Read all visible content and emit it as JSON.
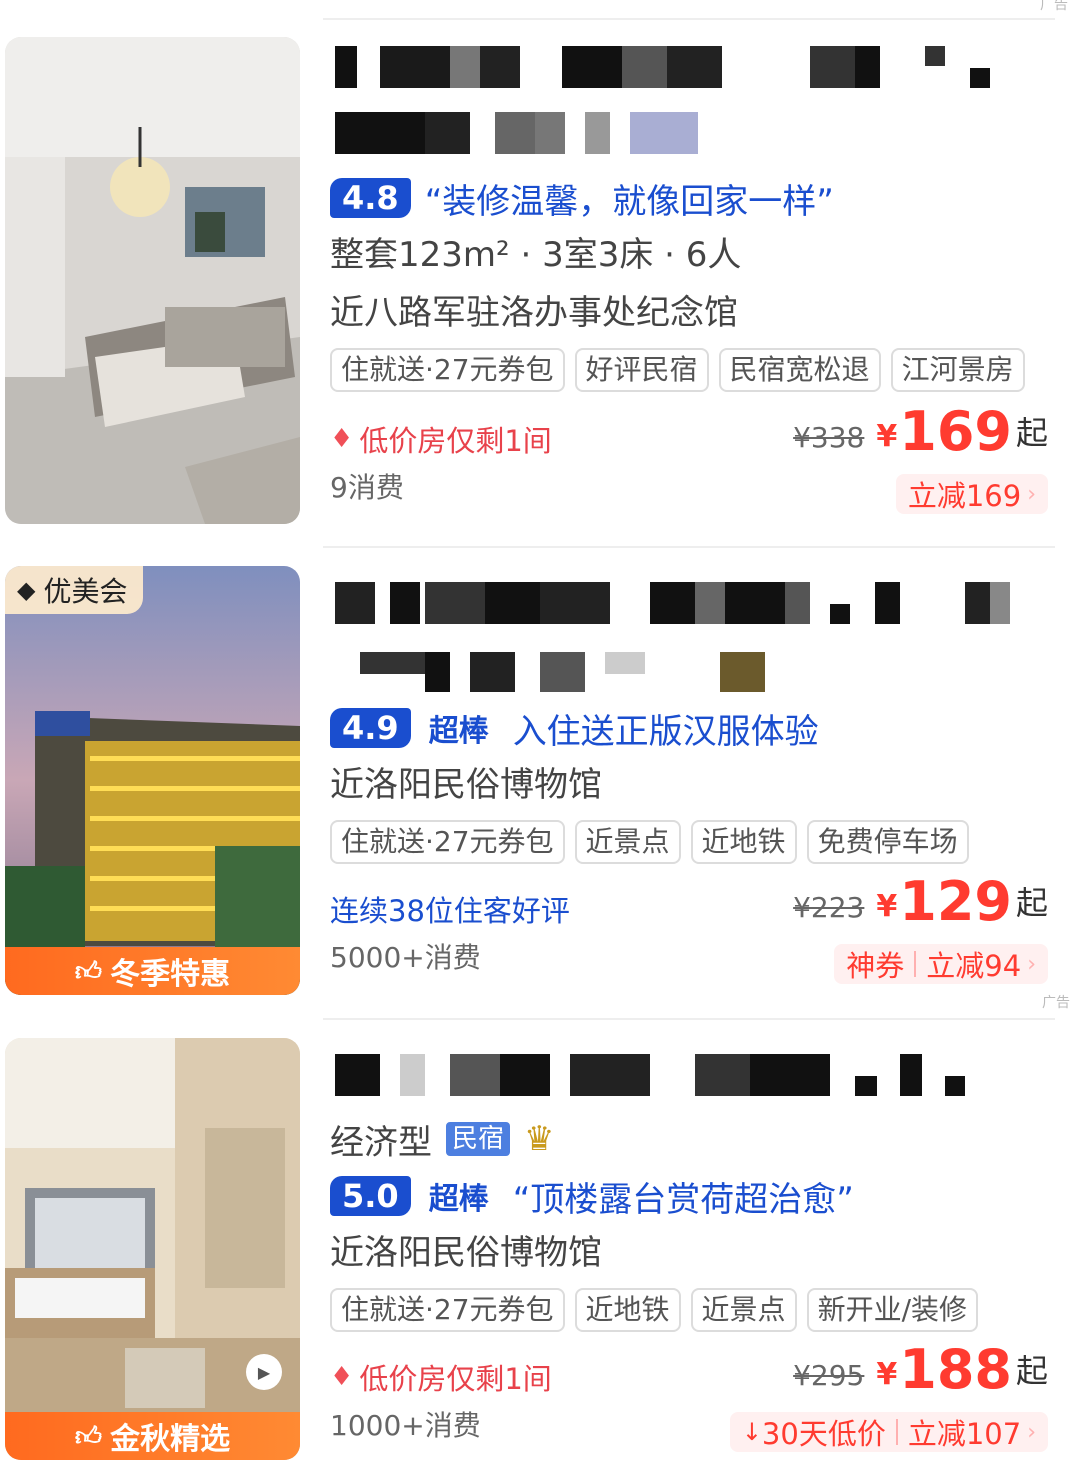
{
  "listings": [
    {
      "rating": "4.8",
      "rating_label": "",
      "quote": "“装修温馨，就像回家一样”",
      "layout": "整套123m² · 3室3床 · 6人",
      "nearby": "近八路军驻洛办事处纪念馆",
      "tags": [
        "住就送·27元券包",
        "好评民宿",
        "民宿宽松退",
        "江河景房"
      ],
      "alert": "低价房仅剩1间",
      "consumption": "9消费",
      "original_price": "¥338",
      "currency": "¥",
      "price": "169",
      "price_suffix": "起",
      "discount": "立减169",
      "thumb_badge": ""
    },
    {
      "corner_badge": "优美会",
      "rating": "4.9",
      "rating_label": "超棒",
      "quote": "入住送正版汉服体验",
      "nearby": "近洛阳民俗博物馆",
      "tags": [
        "住就送·27元券包",
        "近景点",
        "近地铁",
        "免费停车场"
      ],
      "review": "连续38位住客好评",
      "consumption": "5000+消费",
      "original_price": "¥223",
      "currency": "¥",
      "price": "129",
      "price_suffix": "起",
      "coupon": "神券",
      "discount": "立减94",
      "thumb_badge": "冬季特惠",
      "ad": "广告"
    },
    {
      "type": "经济型",
      "type_badge": "民宿",
      "rating": "5.0",
      "rating_label": "超棒",
      "quote": "“顶楼露台赏荷超治愈”",
      "nearby": "近洛阳民俗博物馆",
      "tags": [
        "住就送·27元券包",
        "近地铁",
        "近景点",
        "新开业/装修"
      ],
      "alert": "低价房仅剩1间",
      "consumption": "1000+消费",
      "original_price": "¥295",
      "currency": "¥",
      "price": "188",
      "price_suffix": "起",
      "low_price": "30天低价",
      "discount": "立减107",
      "thumb_badge": "金秋精选"
    }
  ],
  "top_ad": "广告"
}
